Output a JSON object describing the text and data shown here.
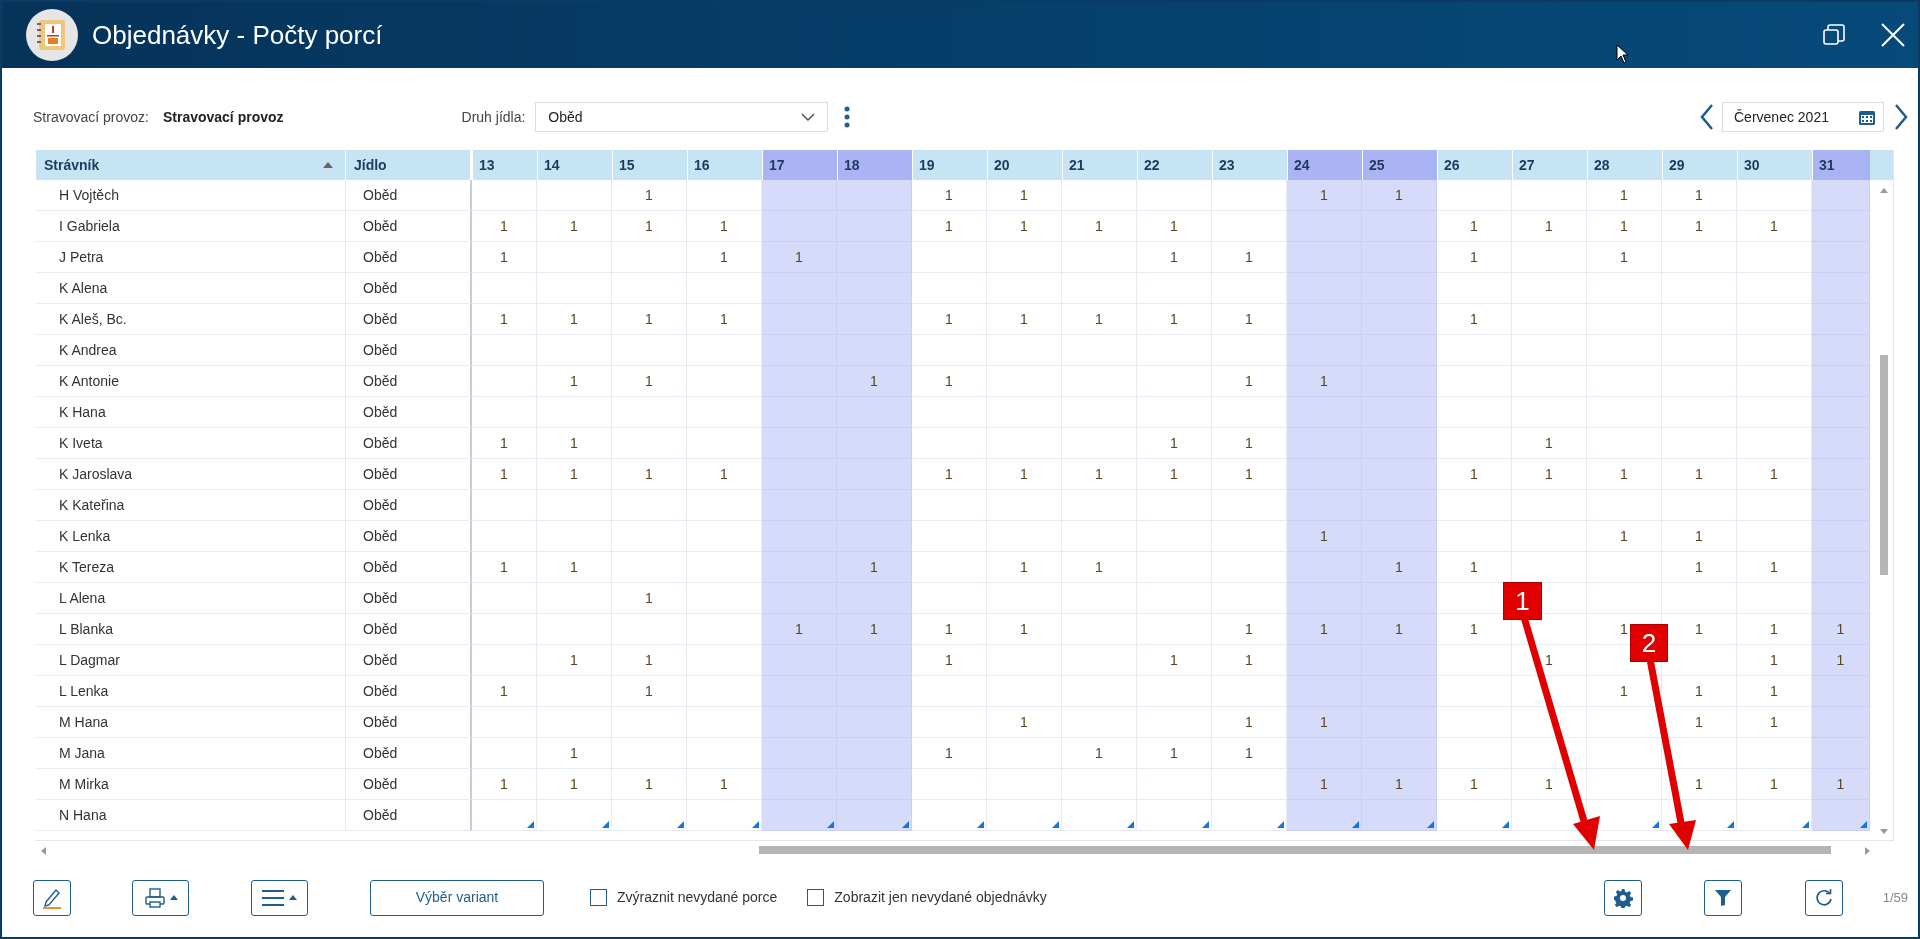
{
  "window": {
    "title": "Objednávky - Počty porcí"
  },
  "filters": {
    "canteen_label": "Stravovací provoz:",
    "canteen_value": "Stravovací provoz",
    "meal_type_label": "Druh jídla:",
    "meal_type_value": "Oběd"
  },
  "month_picker": {
    "value": "Červenec 2021"
  },
  "table": {
    "columns": [
      {
        "label": "Strávník",
        "sorted": true
      },
      {
        "label": "Jídlo",
        "sorted": false
      }
    ],
    "days": [
      {
        "label": "13",
        "weekend": false
      },
      {
        "label": "14",
        "weekend": false
      },
      {
        "label": "15",
        "weekend": false
      },
      {
        "label": "16",
        "weekend": false
      },
      {
        "label": "17",
        "weekend": true
      },
      {
        "label": "18",
        "weekend": true
      },
      {
        "label": "19",
        "weekend": false
      },
      {
        "label": "20",
        "weekend": false
      },
      {
        "label": "21",
        "weekend": false
      },
      {
        "label": "22",
        "weekend": false
      },
      {
        "label": "23",
        "weekend": false
      },
      {
        "label": "24",
        "weekend": true
      },
      {
        "label": "25",
        "weekend": true
      },
      {
        "label": "26",
        "weekend": false
      },
      {
        "label": "27",
        "weekend": false
      },
      {
        "label": "28",
        "weekend": false
      },
      {
        "label": "29",
        "weekend": false
      },
      {
        "label": "30",
        "weekend": false
      },
      {
        "label": "31",
        "weekend": true
      }
    ],
    "rows": [
      {
        "name": "H Vojtěch",
        "meal": "Oběd",
        "corner_marks": false,
        "cells": [
          null,
          null,
          "1",
          null,
          null,
          null,
          "1",
          "1",
          null,
          null,
          null,
          "1",
          "1",
          null,
          null,
          "1",
          "1",
          null,
          null
        ]
      },
      {
        "name": "I Gabriela",
        "meal": "Oběd",
        "corner_marks": false,
        "cells": [
          "1",
          "1",
          "1",
          "1",
          null,
          null,
          "1",
          "1",
          "1",
          "1",
          null,
          null,
          null,
          "1",
          "1",
          "1",
          "1",
          "1",
          null
        ]
      },
      {
        "name": "J Petra",
        "meal": "Oběd",
        "corner_marks": false,
        "cells": [
          "1",
          null,
          null,
          "1",
          "1",
          null,
          null,
          null,
          null,
          "1",
          "1",
          null,
          null,
          "1",
          null,
          "1",
          null,
          null,
          null
        ]
      },
      {
        "name": "K Alena",
        "meal": "Oběd",
        "corner_marks": false,
        "cells": [
          null,
          null,
          null,
          null,
          null,
          null,
          null,
          null,
          null,
          null,
          null,
          null,
          null,
          null,
          null,
          null,
          null,
          null,
          null
        ]
      },
      {
        "name": "K Aleš, Bc.",
        "meal": "Oběd",
        "corner_marks": false,
        "cells": [
          "1",
          "1",
          "1",
          "1",
          null,
          null,
          "1",
          "1",
          "1",
          "1",
          "1",
          null,
          null,
          "1",
          null,
          null,
          null,
          null,
          null
        ]
      },
      {
        "name": "K Andrea",
        "meal": "Oběd",
        "corner_marks": false,
        "cells": [
          null,
          null,
          null,
          null,
          null,
          null,
          null,
          null,
          null,
          null,
          null,
          null,
          null,
          null,
          null,
          null,
          null,
          null,
          null
        ]
      },
      {
        "name": "K Antonie",
        "meal": "Oběd",
        "corner_marks": false,
        "cells": [
          null,
          "1",
          "1",
          null,
          null,
          "1",
          "1",
          null,
          null,
          null,
          "1",
          "1",
          null,
          null,
          null,
          null,
          null,
          null,
          null
        ]
      },
      {
        "name": "K Hana",
        "meal": "Oběd",
        "corner_marks": false,
        "cells": [
          null,
          null,
          null,
          null,
          null,
          null,
          null,
          null,
          null,
          null,
          null,
          null,
          null,
          null,
          null,
          null,
          null,
          null,
          null
        ]
      },
      {
        "name": "K Iveta",
        "meal": "Oběd",
        "corner_marks": false,
        "cells": [
          "1",
          "1",
          null,
          null,
          null,
          null,
          null,
          null,
          null,
          "1",
          "1",
          null,
          null,
          null,
          "1",
          null,
          null,
          null,
          null
        ]
      },
      {
        "name": "K Jaroslava",
        "meal": "Oběd",
        "corner_marks": false,
        "cells": [
          "1",
          "1",
          "1",
          "1",
          null,
          null,
          "1",
          "1",
          "1",
          "1",
          "1",
          null,
          null,
          "1",
          "1",
          "1",
          "1",
          "1",
          null
        ]
      },
      {
        "name": "K Kateřina",
        "meal": "Oběd",
        "corner_marks": false,
        "cells": [
          null,
          null,
          null,
          null,
          null,
          null,
          null,
          null,
          null,
          null,
          null,
          null,
          null,
          null,
          null,
          null,
          null,
          null,
          null
        ]
      },
      {
        "name": "K Lenka",
        "meal": "Oběd",
        "corner_marks": false,
        "cells": [
          null,
          null,
          null,
          null,
          null,
          null,
          null,
          null,
          null,
          null,
          null,
          "1",
          null,
          null,
          null,
          "1",
          "1",
          null,
          null
        ]
      },
      {
        "name": "K Tereza",
        "meal": "Oběd",
        "corner_marks": false,
        "cells": [
          "1",
          "1",
          null,
          null,
          null,
          "1",
          null,
          "1",
          "1",
          null,
          null,
          null,
          "1",
          "1",
          null,
          null,
          "1",
          "1",
          null
        ]
      },
      {
        "name": "L Alena",
        "meal": "Oběd",
        "corner_marks": false,
        "cells": [
          null,
          null,
          "1",
          null,
          null,
          null,
          null,
          null,
          null,
          null,
          null,
          null,
          null,
          null,
          null,
          null,
          null,
          null,
          null
        ]
      },
      {
        "name": "L Blanka",
        "meal": "Oběd",
        "corner_marks": false,
        "cells": [
          null,
          null,
          null,
          null,
          "1",
          "1",
          "1",
          "1",
          null,
          null,
          "1",
          "1",
          "1",
          "1",
          null,
          "1",
          "1",
          "1",
          "1"
        ]
      },
      {
        "name": "L Dagmar",
        "meal": "Oběd",
        "corner_marks": false,
        "cells": [
          null,
          "1",
          "1",
          null,
          null,
          null,
          "1",
          null,
          null,
          "1",
          "1",
          null,
          null,
          null,
          "1",
          null,
          null,
          "1",
          "1"
        ]
      },
      {
        "name": "L Lenka",
        "meal": "Oběd",
        "corner_marks": false,
        "cells": [
          "1",
          null,
          "1",
          null,
          null,
          null,
          null,
          null,
          null,
          null,
          null,
          null,
          null,
          null,
          null,
          "1",
          "1",
          "1",
          null
        ]
      },
      {
        "name": "M Hana",
        "meal": "Oběd",
        "corner_marks": false,
        "cells": [
          null,
          null,
          null,
          null,
          null,
          null,
          null,
          "1",
          null,
          null,
          "1",
          "1",
          null,
          null,
          null,
          null,
          "1",
          "1",
          null
        ]
      },
      {
        "name": "M Jana",
        "meal": "Oběd",
        "corner_marks": false,
        "cells": [
          null,
          "1",
          null,
          null,
          null,
          null,
          "1",
          null,
          "1",
          "1",
          "1",
          null,
          null,
          null,
          null,
          null,
          null,
          null,
          null
        ]
      },
      {
        "name": "M Mirka",
        "meal": "Oběd",
        "corner_marks": false,
        "cells": [
          "1",
          "1",
          "1",
          "1",
          null,
          null,
          null,
          null,
          null,
          null,
          null,
          "1",
          "1",
          "1",
          "1",
          null,
          "1",
          "1",
          "1"
        ]
      },
      {
        "name": "N Hana",
        "meal": "Oběd",
        "corner_marks": true,
        "cells": [
          null,
          null,
          null,
          null,
          null,
          null,
          null,
          null,
          null,
          null,
          null,
          null,
          null,
          null,
          null,
          null,
          null,
          null,
          null
        ]
      }
    ]
  },
  "toolbar": {
    "variants_button": "Výběr variant",
    "checkboxes": [
      {
        "label": "Zvýraznit nevydané porce",
        "checked": false
      },
      {
        "label": "Zobrazit jen nevydané objednávky",
        "checked": false
      }
    ],
    "page_counter": "1/59"
  },
  "callouts": [
    {
      "label": "1"
    },
    {
      "label": "2"
    }
  ]
}
